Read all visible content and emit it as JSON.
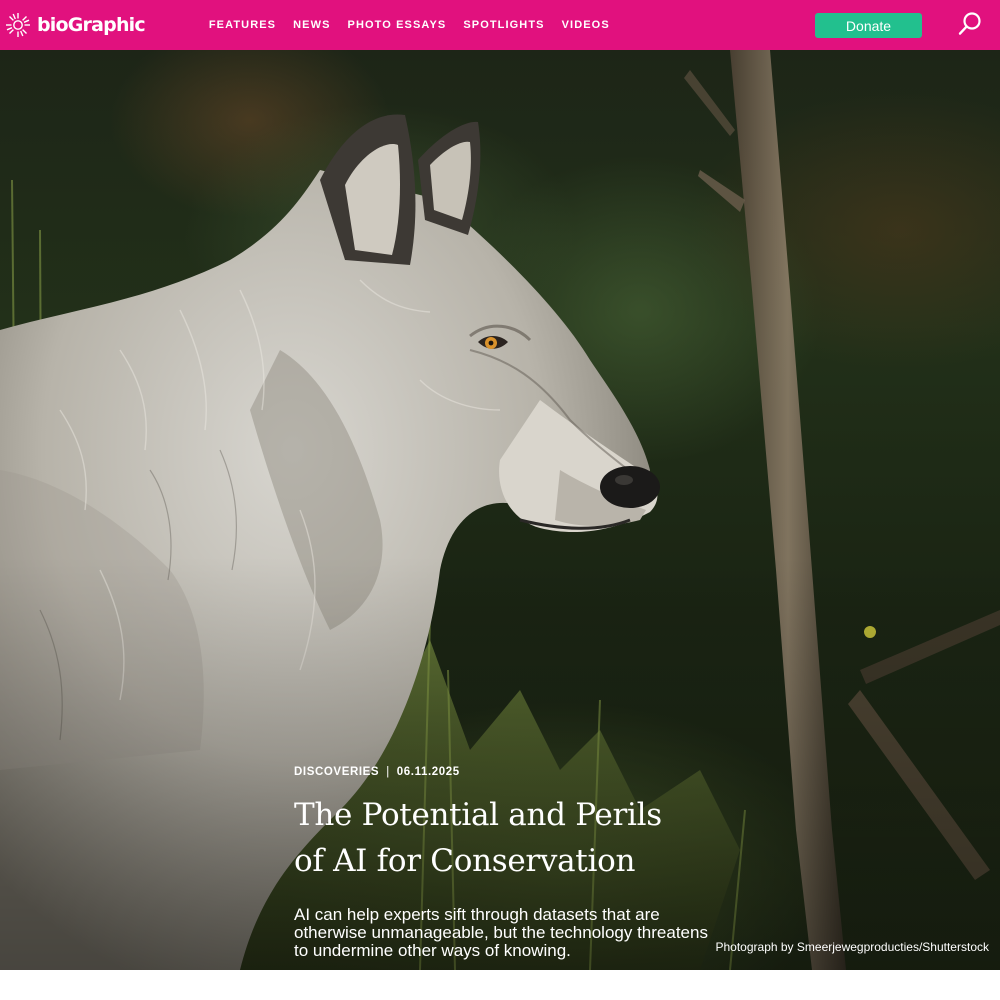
{
  "header": {
    "logo_text": "bioGraphic",
    "nav": [
      {
        "label": "Features"
      },
      {
        "label": "News"
      },
      {
        "label": "Photo Essays"
      },
      {
        "label": "Spotlights"
      },
      {
        "label": "Videos"
      }
    ],
    "donate_label": "Donate",
    "search_icon": "search-icon",
    "brand_color": "#e1117e",
    "donate_color": "#22c08e"
  },
  "hero": {
    "image_subject": "gray wolf in profile",
    "category": "Discoveries",
    "separator": "|",
    "date": "06.11.2025",
    "title_line1": "The Potential and Perils",
    "title_line2": "of AI for Conservation",
    "dek": "AI can help experts sift through datasets that are otherwise unmanageable, but the technology threatens to undermine other ways of knowing.",
    "credit": "Photograph by Smeerjewegproducties/Shutterstock"
  }
}
